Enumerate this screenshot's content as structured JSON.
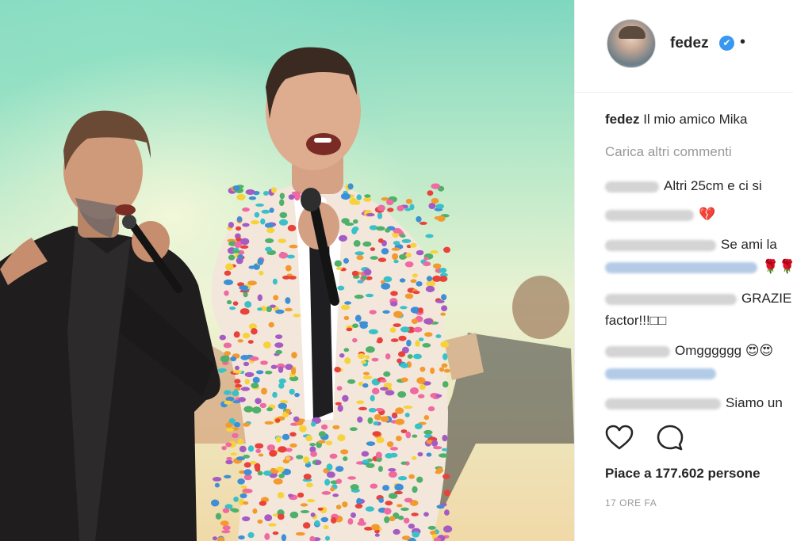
{
  "post": {
    "username": "fedez",
    "verified_mark": "✔",
    "separator": "•",
    "caption_user": "fedez",
    "caption_text": "Il mio amico Mika"
  },
  "comments": {
    "load_more": "Carica altri commenti",
    "items": [
      {
        "user_hidden": true,
        "text": "Altri 25cm e ci si"
      },
      {
        "user_hidden": true,
        "text": "💔"
      },
      {
        "user_hidden": true,
        "text": "Se ami la"
      },
      {
        "user_hidden": true,
        "mention_hidden": true,
        "text": "🌹🌹"
      },
      {
        "user_hidden": true,
        "text": "GRAZIE"
      },
      {
        "text": "factor!!!□□"
      },
      {
        "user_hidden": true,
        "text": "Omgggggg 😍😍"
      },
      {
        "user_hidden": true,
        "mention_hidden": true,
        "text": ""
      },
      {
        "user_hidden": true,
        "text": "Siamo un"
      }
    ]
  },
  "actions": {
    "like_icon": "heart-icon",
    "comment_icon": "speech-bubble-icon"
  },
  "likes_text": "Piace a 177.602 persone",
  "timestamp": "17 ORE FA",
  "colors": {
    "verified": "#3897f0",
    "muted": "#999999",
    "text": "#262626"
  }
}
